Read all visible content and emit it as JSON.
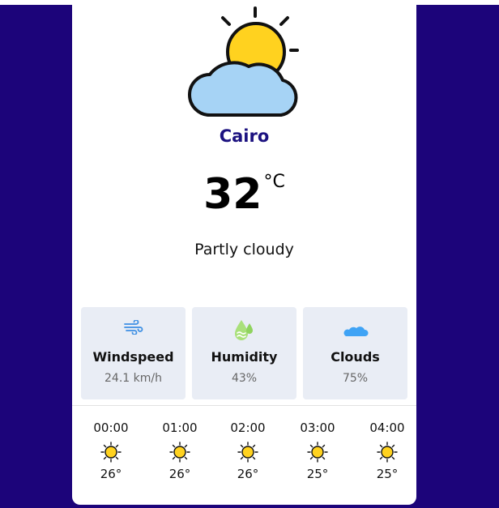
{
  "location": {
    "city": "Cairo"
  },
  "current": {
    "temperature": "32",
    "unit": "°C",
    "condition": "Partly cloudy",
    "icon": "partly-cloudy-icon"
  },
  "stats": [
    {
      "label": "Windspeed",
      "value": "24.1 km/h",
      "icon": "wind-icon"
    },
    {
      "label": "Humidity",
      "value": "43%",
      "icon": "humidity-icon"
    },
    {
      "label": "Clouds",
      "value": "75%",
      "icon": "cloud-icon"
    }
  ],
  "hourly": [
    {
      "time": "00:00",
      "temp": "26°",
      "icon": "sun-icon"
    },
    {
      "time": "01:00",
      "temp": "26°",
      "icon": "sun-icon"
    },
    {
      "time": "02:00",
      "temp": "26°",
      "icon": "sun-icon"
    },
    {
      "time": "03:00",
      "temp": "25°",
      "icon": "sun-icon"
    },
    {
      "time": "04:00",
      "temp": "25°",
      "icon": "sun-icon"
    }
  ],
  "colors": {
    "background": "#1c047a",
    "city": "#1c1280",
    "stat_card": "#e9edf5",
    "sun": "#ffd21f",
    "cloud": "#a6d3f5"
  }
}
